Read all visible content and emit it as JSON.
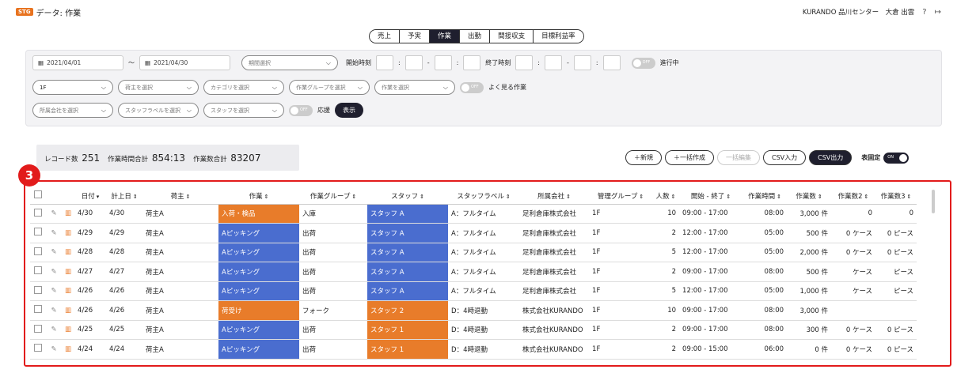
{
  "header": {
    "badge": "STG",
    "title": "データ: 作業",
    "user": "KURANDO 品川センター　大倉 出雲",
    "help_icon": "?",
    "logout_icon": "↦"
  },
  "tabs": [
    "売上",
    "予実",
    "作業",
    "出勤",
    "間接収支",
    "目標利益率"
  ],
  "active_tab": "作業",
  "filters": {
    "date_from": "2021/04/01",
    "date_sep": "〜",
    "date_to": "2021/04/30",
    "period_placeholder": "期間選択",
    "start_time_label": "開始時刻",
    "end_time_label": "終了時刻",
    "in_progress_toggle": "OFF",
    "in_progress_label": "進行中",
    "floor": "1F",
    "shipper_placeholder": "荷主を選択",
    "category_placeholder": "カテゴリを選択",
    "group_placeholder": "作業グループを選択",
    "work_placeholder": "作業を選択",
    "frequent_toggle": "OFF",
    "frequent_label": "よく見る作業",
    "company_placeholder": "所属会社を選択",
    "staff_label_placeholder": "スタッフラベルを選択",
    "staff_placeholder": "スタッフを選択",
    "support_toggle": "OFF",
    "support_label": "応援",
    "show_button": "表示"
  },
  "summary": {
    "records_label": "レコード数",
    "records_value": "251",
    "hours_label": "作業時間合計",
    "hours_value": "854:13",
    "count_label": "作業数合計",
    "count_value": "83207"
  },
  "actions": {
    "new": "＋新規",
    "bulk_create": "＋一括作成",
    "bulk_edit": "一括編集",
    "csv_in": "CSV入力",
    "csv_out": "CSV出力",
    "fixed_label": "表固定",
    "fixed_toggle": "ON"
  },
  "annotation_number": "3",
  "table": {
    "columns": [
      "日付",
      "計上日",
      "荷主",
      "作業",
      "作業グループ",
      "スタッフ",
      "スタッフラベル",
      "所属会社",
      "管理グループ",
      "人数",
      "開始 - 終了",
      "作業時間",
      "作業数",
      "作業数2",
      "作業数3"
    ],
    "rows": [
      {
        "date": "4/30",
        "rec": "4/30",
        "shipper": "荷主A",
        "work": "入荷・検品",
        "work_color": "o",
        "group": "入庫",
        "staff": "スタッフ A",
        "staff_color": "b",
        "label": "A：フルタイム",
        "company": "足利倉庫株式会社",
        "mgmt": "1F",
        "people": "10",
        "time": "09:00 - 17:00",
        "hours": "08:00",
        "count": "3,000 件",
        "count2": "0",
        "count3": "0"
      },
      {
        "date": "4/29",
        "rec": "4/29",
        "shipper": "荷主A",
        "work": "Aピッキング",
        "work_color": "b",
        "group": "出荷",
        "staff": "スタッフ A",
        "staff_color": "b",
        "label": "A：フルタイム",
        "company": "足利倉庫株式会社",
        "mgmt": "1F",
        "people": "2",
        "time": "12:00 - 17:00",
        "hours": "05:00",
        "count": "500 件",
        "count2": "0 ケース",
        "count3": "0 ピース"
      },
      {
        "date": "4/28",
        "rec": "4/28",
        "shipper": "荷主A",
        "work": "Aピッキング",
        "work_color": "b",
        "group": "出荷",
        "staff": "スタッフ A",
        "staff_color": "b",
        "label": "A：フルタイム",
        "company": "足利倉庫株式会社",
        "mgmt": "1F",
        "people": "5",
        "time": "12:00 - 17:00",
        "hours": "05:00",
        "count": "2,000 件",
        "count2": "0 ケース",
        "count3": "0 ピース"
      },
      {
        "date": "4/27",
        "rec": "4/27",
        "shipper": "荷主A",
        "work": "Aピッキング",
        "work_color": "b",
        "group": "出荷",
        "staff": "スタッフ A",
        "staff_color": "b",
        "label": "A：フルタイム",
        "company": "足利倉庫株式会社",
        "mgmt": "1F",
        "people": "2",
        "time": "09:00 - 17:00",
        "hours": "08:00",
        "count": "500 件",
        "count2": "ケース",
        "count3": "ピース"
      },
      {
        "date": "4/26",
        "rec": "4/26",
        "shipper": "荷主A",
        "work": "Aピッキング",
        "work_color": "b",
        "group": "出荷",
        "staff": "スタッフ A",
        "staff_color": "b",
        "label": "A：フルタイム",
        "company": "足利倉庫株式会社",
        "mgmt": "1F",
        "people": "5",
        "time": "12:00 - 17:00",
        "hours": "05:00",
        "count": "1,000 件",
        "count2": "ケース",
        "count3": "ピース"
      },
      {
        "date": "4/26",
        "rec": "4/26",
        "shipper": "荷主A",
        "work": "荷受け",
        "work_color": "o",
        "group": "フォーク",
        "staff": "スタッフ 2",
        "staff_color": "o",
        "label": "D：4時退勤",
        "company": "株式会社KURANDO",
        "mgmt": "1F",
        "people": "10",
        "time": "09:00 - 17:00",
        "hours": "08:00",
        "count": "3,000 件",
        "count2": "",
        "count3": ""
      },
      {
        "date": "4/25",
        "rec": "4/25",
        "shipper": "荷主A",
        "work": "Aピッキング",
        "work_color": "b",
        "group": "出荷",
        "staff": "スタッフ 1",
        "staff_color": "o",
        "label": "D：4時退勤",
        "company": "株式会社KURANDO",
        "mgmt": "1F",
        "people": "2",
        "time": "09:00 - 17:00",
        "hours": "08:00",
        "count": "300 件",
        "count2": "0 ケース",
        "count3": "0 ピース"
      },
      {
        "date": "4/24",
        "rec": "4/24",
        "shipper": "荷主A",
        "work": "Aピッキング",
        "work_color": "b",
        "group": "出荷",
        "staff": "スタッフ 1",
        "staff_color": "o",
        "label": "D：4時退勤",
        "company": "株式会社KURANDO",
        "mgmt": "1F",
        "people": "2",
        "time": "09:00 - 15:00",
        "hours": "06:00",
        "count": "0 件",
        "count2": "0 ケース",
        "count3": "0 ピース"
      }
    ]
  },
  "colors": {
    "accent_orange": "#e87c2a",
    "accent_blue": "#4a6dcf",
    "highlight_red": "#e21b1b",
    "dark": "#1f1f2e"
  }
}
